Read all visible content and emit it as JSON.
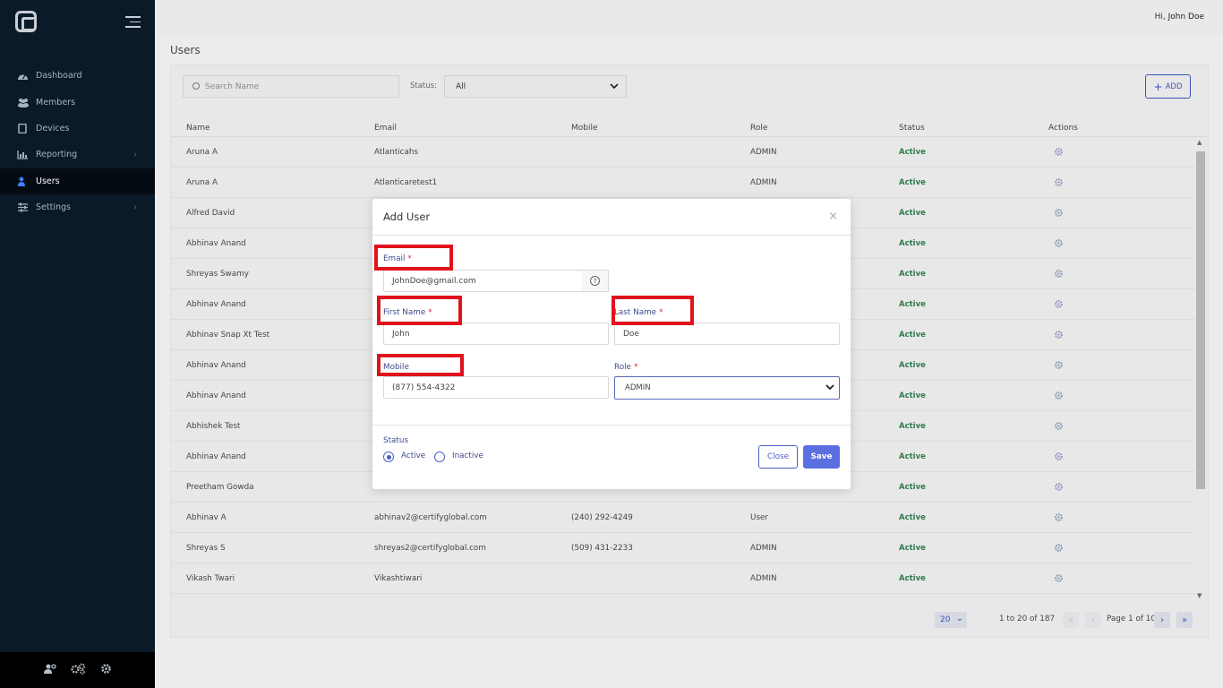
{
  "header": {
    "greeting_prefix": "Hi,",
    "user_name": "John Doe"
  },
  "sidebar": {
    "items": [
      {
        "label": "Dashboard",
        "icon": "dashboard-icon"
      },
      {
        "label": "Members",
        "icon": "members-icon"
      },
      {
        "label": "Devices",
        "icon": "devices-icon"
      },
      {
        "label": "Reporting",
        "icon": "reporting-icon",
        "chevron": "›"
      },
      {
        "label": "Users",
        "icon": "user-icon",
        "active": true
      },
      {
        "label": "Settings",
        "icon": "settings-icon",
        "chevron": "›"
      }
    ],
    "bottom_icons": [
      "user-settings-icon",
      "gears-icon",
      "gear-icon"
    ]
  },
  "page": {
    "title": "Users"
  },
  "toolbar": {
    "search_placeholder": "Search Name",
    "status_label": "Status:",
    "status_value": "All",
    "add_label": "ADD",
    "add_plus": "+"
  },
  "table": {
    "columns": [
      "Name",
      "Email",
      "Mobile",
      "Role",
      "Status",
      "Actions"
    ],
    "rows": [
      {
        "name": "Aruna A",
        "email": "Atlanticahs",
        "mobile": "",
        "role": "ADMIN",
        "status": "Active"
      },
      {
        "name": "Aruna A",
        "email": "Atlanticaretest1",
        "mobile": "",
        "role": "ADMIN",
        "status": "Active"
      },
      {
        "name": "Alfred David",
        "email": "",
        "mobile": "",
        "role": "",
        "status": "Active"
      },
      {
        "name": "Abhinav Anand",
        "email": "",
        "mobile": "",
        "role": "",
        "status": "Active"
      },
      {
        "name": "Shreyas Swamy",
        "email": "",
        "mobile": "",
        "role": "",
        "status": "Active"
      },
      {
        "name": "Abhinav Anand",
        "email": "",
        "mobile": "",
        "role": "",
        "status": "Active"
      },
      {
        "name": "Abhinav Snap Xt Test",
        "email": "",
        "mobile": "",
        "role": "",
        "status": "Active"
      },
      {
        "name": "Abhinav Anand",
        "email": "",
        "mobile": "",
        "role": "",
        "status": "Active"
      },
      {
        "name": "Abhinav Anand",
        "email": "",
        "mobile": "",
        "role": "",
        "status": "Active"
      },
      {
        "name": "Abhishek Test",
        "email": "",
        "mobile": "",
        "role": "",
        "status": "Active"
      },
      {
        "name": "Abhinav Anand",
        "email": "",
        "mobile": "",
        "role": "",
        "status": "Active"
      },
      {
        "name": "Preetham Gowda",
        "email": "",
        "mobile": "",
        "role": "",
        "status": "Active"
      },
      {
        "name": "Abhinav A",
        "email": "abhinav2@certifyglobal.com",
        "mobile": "(240) 292-4249",
        "role": "User",
        "status": "Active"
      },
      {
        "name": "Shreyas S",
        "email": "shreyas2@certifyglobal.com",
        "mobile": "(509) 431-2233",
        "role": "ADMIN",
        "status": "Active"
      },
      {
        "name": "Vikash Twari",
        "email": "Vikashtiwari",
        "mobile": "",
        "role": "ADMIN",
        "status": "Active"
      }
    ]
  },
  "pagination": {
    "page_size": "20",
    "range": "1 to 20 of 187",
    "page_text": "Page 1 of 10"
  },
  "modal": {
    "title": "Add User",
    "close_glyph": "×",
    "email_label": "Email",
    "email_value": "JohnDoe@gmail.com",
    "first_name_label": "First Name",
    "first_name_value": "John",
    "last_name_label": "Last Name",
    "last_name_value": "Doe",
    "mobile_label": "Mobile",
    "mobile_value": "(877) 554-4322",
    "role_label": "Role",
    "role_value": "ADMIN",
    "required_mark": "*",
    "status_label": "Status",
    "status_options": [
      "Active",
      "Inactive"
    ],
    "status_selected": "Active",
    "close_label": "Close",
    "save_label": "Save"
  },
  "colors": {
    "sidebar_bg": "#0b1a28",
    "accent": "#4a5fc1",
    "status_active": "#2f7a4d",
    "highlight": "#e0131d"
  }
}
